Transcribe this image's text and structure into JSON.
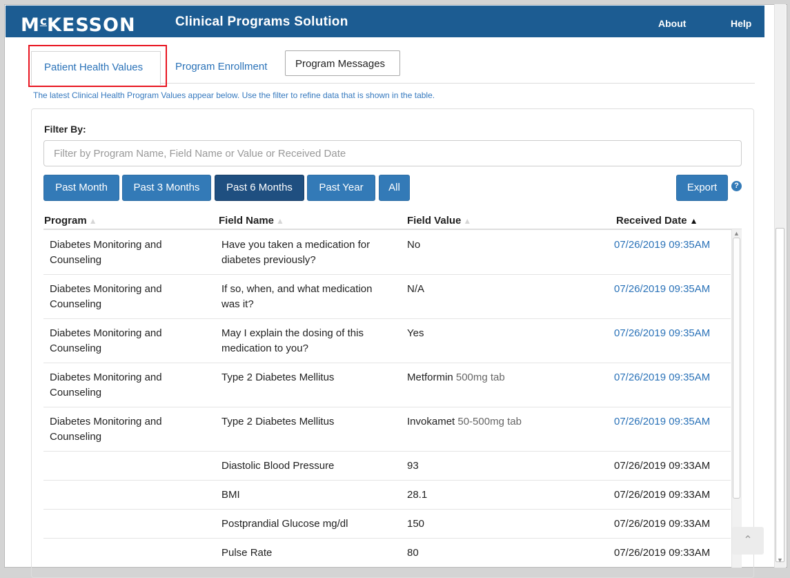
{
  "header": {
    "logo_main": "M",
    "logo_sup": "c",
    "logo_rest": "KESSON",
    "title": "Clinical Programs Solution",
    "about": "About",
    "help": "Help"
  },
  "tabs": [
    {
      "label": "Patient Health Values",
      "active": true
    },
    {
      "label": "Program Enrollment",
      "active": false
    },
    {
      "label": "Program Messages",
      "active": false
    }
  ],
  "intro_text": "The latest Clinical Health Program Values appear below. Use the filter to refine data that is shown in the table.",
  "filter": {
    "label": "Filter By:",
    "placeholder": "Filter by Program Name, Field Name or Value or Received Date",
    "value": ""
  },
  "range_buttons": [
    {
      "label": "Past Month",
      "active": false
    },
    {
      "label": "Past 3 Months",
      "active": false
    },
    {
      "label": "Past 6 Months",
      "active": true
    },
    {
      "label": "Past Year",
      "active": false
    },
    {
      "label": "All",
      "active": false
    }
  ],
  "export_label": "Export",
  "help_icon_glyph": "?",
  "table": {
    "columns": [
      "Program",
      "Field Name",
      "Field Value",
      "Received Date"
    ],
    "sorted_column": "Received Date",
    "sort_direction": "descending",
    "rows": [
      {
        "program": [
          "Diabetes Monitoring and",
          "Counseling"
        ],
        "field": [
          "Have you taken a medication for",
          "diabetes previously?"
        ],
        "value": "No",
        "value_extra": "",
        "date": "07/26/2019 09:35AM",
        "date_link": true
      },
      {
        "program": [
          "Diabetes Monitoring and",
          "Counseling"
        ],
        "field": [
          "If so, when, and what medication",
          "was it?"
        ],
        "value": "N/A",
        "value_extra": "",
        "date": "07/26/2019 09:35AM",
        "date_link": true
      },
      {
        "program": [
          "Diabetes Monitoring and",
          "Counseling"
        ],
        "field": [
          "May I explain the dosing of this",
          "medication to you?"
        ],
        "value": "Yes",
        "value_extra": "",
        "date": "07/26/2019 09:35AM",
        "date_link": true
      },
      {
        "program": [
          "Diabetes Monitoring and",
          "Counseling"
        ],
        "field": [
          "Type 2 Diabetes Mellitus",
          ""
        ],
        "value": "Metformin",
        "value_extra": " 500mg tab",
        "date": "07/26/2019 09:35AM",
        "date_link": true
      },
      {
        "program": [
          "Diabetes Monitoring and",
          "Counseling"
        ],
        "field": [
          "Type 2 Diabetes Mellitus",
          ""
        ],
        "value": "Invokamet",
        "value_extra": " 50-500mg tab",
        "date": "07/26/2019 09:35AM",
        "date_link": true
      },
      {
        "program": [
          "",
          ""
        ],
        "field": [
          "Diastolic Blood Pressure",
          ""
        ],
        "value": "93",
        "value_extra": "",
        "date": "07/26/2019 09:33AM",
        "date_link": false
      },
      {
        "program": [
          "",
          ""
        ],
        "field": [
          "BMI",
          ""
        ],
        "value": "28.1",
        "value_extra": "",
        "date": "07/26/2019 09:33AM",
        "date_link": false
      },
      {
        "program": [
          "",
          ""
        ],
        "field": [
          "Postprandial Glucose mg/dl",
          ""
        ],
        "value": "150",
        "value_extra": "",
        "date": "07/26/2019 09:33AM",
        "date_link": false
      },
      {
        "program": [
          "",
          ""
        ],
        "field": [
          "Pulse Rate",
          ""
        ],
        "value": "80",
        "value_extra": "",
        "date": "07/26/2019 09:33AM",
        "date_link": false
      }
    ]
  },
  "colors": {
    "header_bg": "#1c5c92",
    "button_primary": "#337ab7",
    "button_active": "#1f4f80",
    "link": "#2a72b8",
    "tab_highlight": "#e8141f"
  },
  "icons": {
    "sort_idle": "chevron-up",
    "sort_active": "chevron-up-bold",
    "back_to_top": "chevron-up"
  }
}
